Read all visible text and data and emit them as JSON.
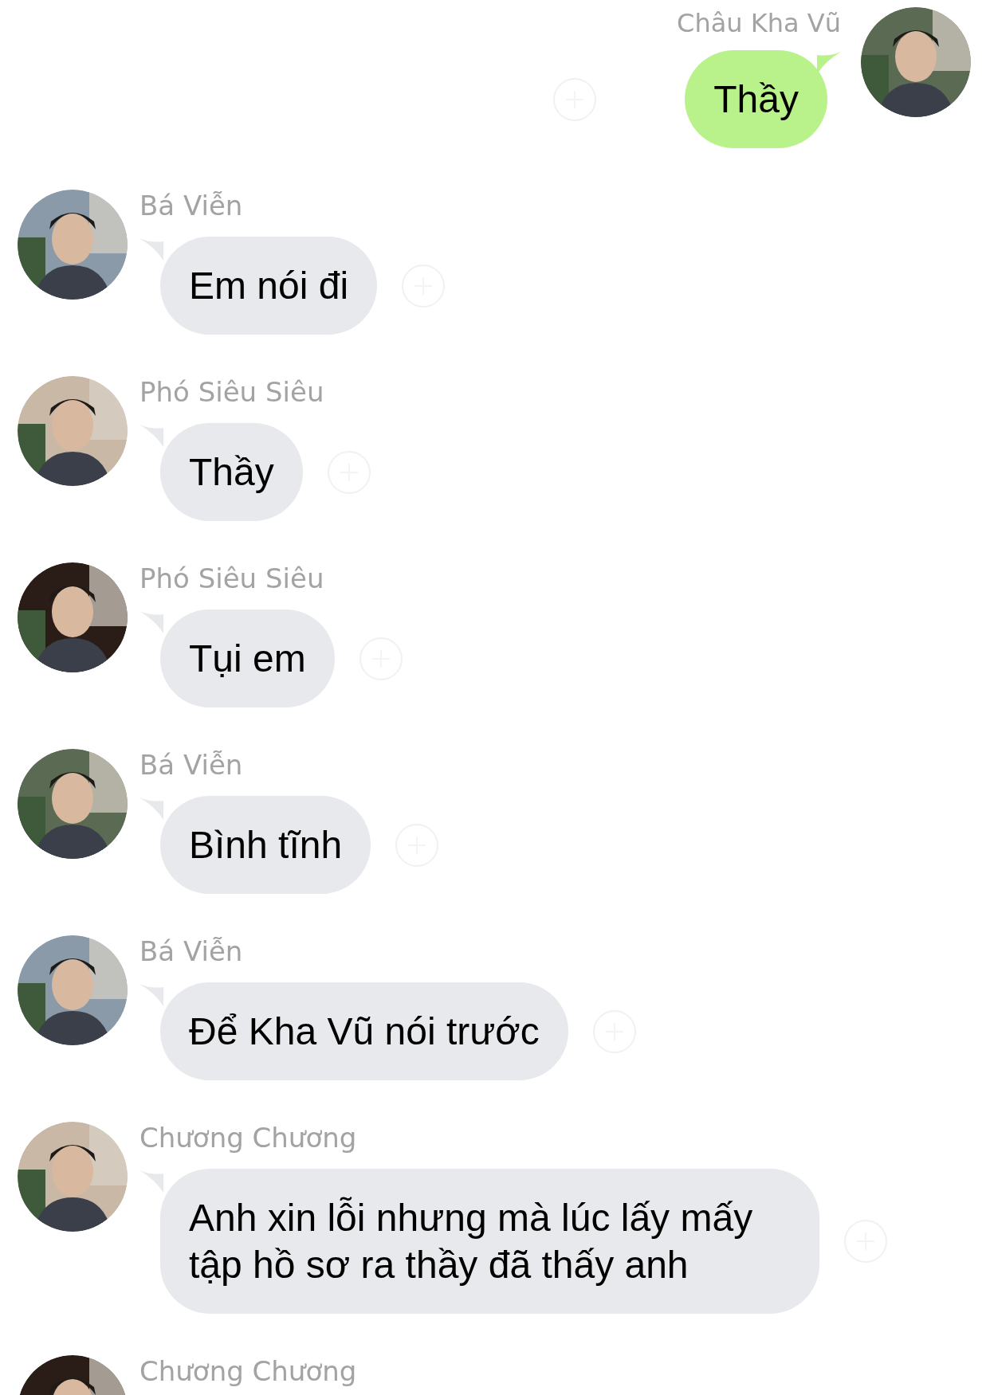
{
  "messages": [
    {
      "kind": "outgoing",
      "sender": "Châu Kha Vũ",
      "text": "Thầy"
    },
    {
      "kind": "incoming",
      "sender": "Bá Viễn",
      "text": "Em nói đi"
    },
    {
      "kind": "incoming",
      "sender": "Phó Siêu Siêu",
      "text": "Thầy"
    },
    {
      "kind": "incoming",
      "sender": "Phó Siêu Siêu",
      "text": "Tụi em"
    },
    {
      "kind": "incoming",
      "sender": "Bá Viễn",
      "text": "Bình tĩnh"
    },
    {
      "kind": "incoming",
      "sender": "Bá Viễn",
      "text": "Để Kha Vũ nói trước"
    },
    {
      "kind": "incoming",
      "sender": "Chương Chương",
      "text": "Anh xin lỗi nhưng mà lúc lấy mấy tập hồ sơ ra thầy đã thấy anh"
    },
    {
      "kind": "incoming",
      "sender": "Chương Chương"
    }
  ]
}
